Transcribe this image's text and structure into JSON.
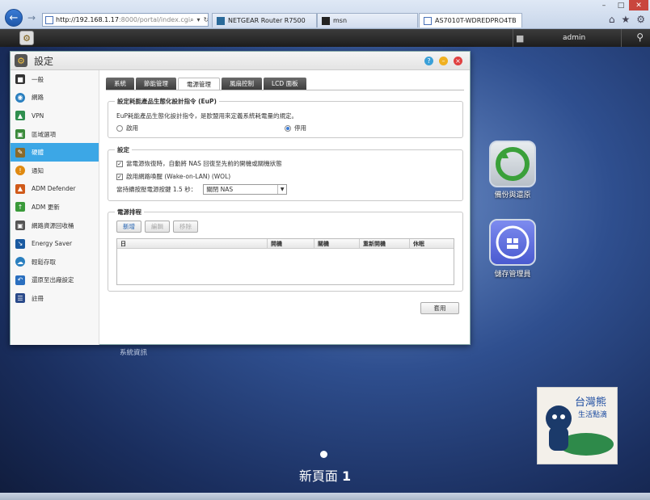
{
  "browser": {
    "address": "http://192.168.1.17:8000/portal/index.cgi",
    "address_host": "http://192.168.1.17",
    "address_tail": ":8000/portal/index.cgi",
    "tabs": [
      {
        "label": "NETGEAR Router R7500"
      },
      {
        "label": "msn"
      },
      {
        "label": "AS7010T-WDREDPRO4TB",
        "active": true
      }
    ]
  },
  "adm": {
    "username": "admin"
  },
  "window": {
    "title": "設定",
    "sidebar": [
      {
        "label": "一般",
        "icon": "monitor-icon",
        "color": "#333333"
      },
      {
        "label": "網路",
        "icon": "globe-icon",
        "color": "#2a7fbf"
      },
      {
        "label": "VPN",
        "icon": "vpn-icon",
        "color": "#2f8f4f"
      },
      {
        "label": "區域選項",
        "icon": "region-icon",
        "color": "#3a8a3a"
      },
      {
        "label": "硬體",
        "icon": "hardware-icon",
        "color": "#8a6a2a",
        "active": true
      },
      {
        "label": "通知",
        "icon": "notification-icon",
        "color": "#e08a10"
      },
      {
        "label": "ADM Defender",
        "icon": "defender-icon",
        "color": "#d05a1a"
      },
      {
        "label": "ADM 更新",
        "icon": "update-icon",
        "color": "#3a9a3a"
      },
      {
        "label": "網路資源回收桶",
        "icon": "recycle-bin-icon",
        "color": "#555555"
      },
      {
        "label": "Energy Saver",
        "icon": "energy-icon",
        "color": "#1a5aa0"
      },
      {
        "label": "輕鬆存取",
        "icon": "cloud-icon",
        "color": "#2a7fbf"
      },
      {
        "label": "還原至出廠設定",
        "icon": "restore-icon",
        "color": "#2a6fbf"
      },
      {
        "label": "註冊",
        "icon": "register-icon",
        "color": "#2a4a8a"
      }
    ],
    "tabs": [
      {
        "label": "系統"
      },
      {
        "label": "節能管理"
      },
      {
        "label": "電源管理",
        "active": true
      },
      {
        "label": "風扇控制"
      },
      {
        "label": "LCD 面板"
      }
    ],
    "eup": {
      "legend": "設定耗能產品生態化設計指令 (EuP)",
      "description": "EuP耗能產品生態化設計指令，是歐盟用來定義系統耗電量的規定。",
      "enable_label": "啟用",
      "disable_label": "停用",
      "selected": "停用"
    },
    "settings": {
      "legend": "設定",
      "power_restore_label": "當電源恢復時，自動將 NAS 回復至先前的開機或關機狀態",
      "power_restore_checked": true,
      "wol_label": "啟用網路喚醒 (Wake-on-LAN) (WOL)",
      "wol_checked": true,
      "long_press_label": "當持續按壓電源按鍵 1.5 秒：",
      "long_press_value": "關閉 NAS"
    },
    "schedule": {
      "legend": "電源排程",
      "add_label": "新增",
      "edit_label": "編輯",
      "remove_label": "移除",
      "columns": [
        "日",
        "開機",
        "關機",
        "重新開機",
        "休眠"
      ]
    },
    "apply_label": "套用"
  },
  "desktop": {
    "icons": [
      {
        "label": "備份與還原",
        "color": "#3aa03a"
      },
      {
        "label": "儲存管理員",
        "color": "#5a6ad8"
      }
    ],
    "system_info_label": "系統資訊",
    "page_label": "新頁面",
    "page_number": "1"
  }
}
